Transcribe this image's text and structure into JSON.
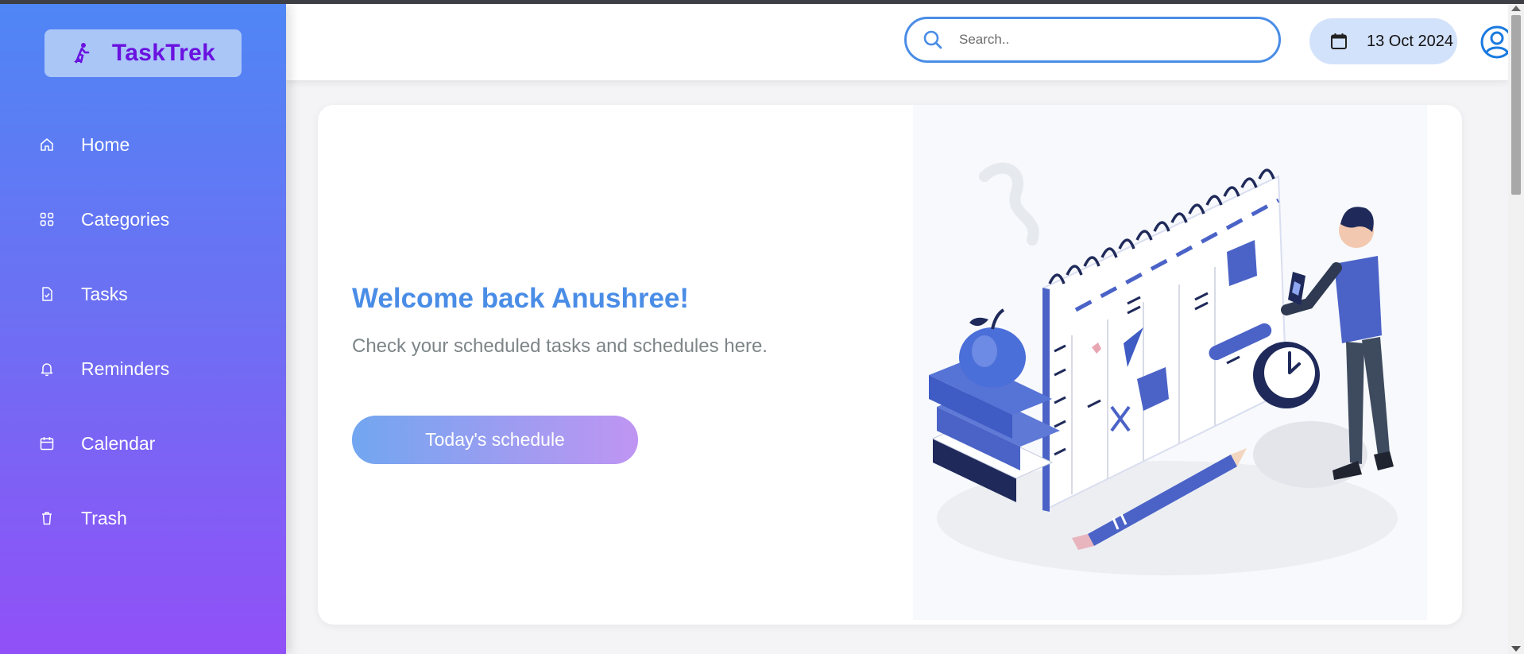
{
  "brand": {
    "name": "TaskTrek",
    "logo_icon": "hiker-icon",
    "color": "#6a12e0"
  },
  "sidebar": {
    "items": [
      {
        "label": "Home",
        "icon": "home-icon"
      },
      {
        "label": "Categories",
        "icon": "grid-icon"
      },
      {
        "label": "Tasks",
        "icon": "task-file-icon"
      },
      {
        "label": "Reminders",
        "icon": "bell-icon"
      },
      {
        "label": "Calendar",
        "icon": "calendar-icon"
      },
      {
        "label": "Trash",
        "icon": "trash-icon"
      }
    ]
  },
  "header": {
    "search": {
      "placeholder": "Search..",
      "value": ""
    },
    "date": "13 Oct 2024",
    "user_icon": "user-circle-icon"
  },
  "main": {
    "welcome_title": "Welcome back Anushree!",
    "welcome_subtitle": "Check your scheduled tasks and schedules here.",
    "cta_label": "Today's schedule",
    "illustration": "person-with-calendar-illustration"
  },
  "colors": {
    "accent": "#4a8de6",
    "sidebar_top": "#4f86f5",
    "sidebar_bottom": "#9150f7",
    "date_chip": "#d3e2fb"
  }
}
